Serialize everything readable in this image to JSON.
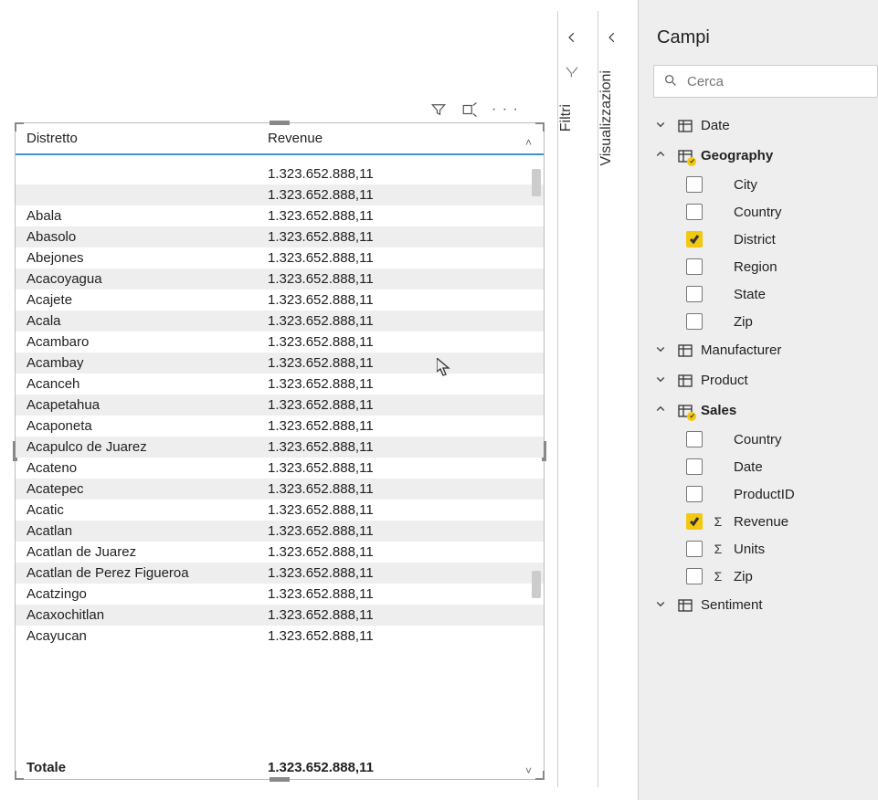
{
  "table": {
    "header": {
      "col_a": "Distretto",
      "col_b": "Revenue"
    },
    "rows": [
      {
        "a": " ",
        "b": "1.323.652.888,11"
      },
      {
        "a": " ",
        "b": "1.323.652.888,11"
      },
      {
        "a": "Abala",
        "b": "1.323.652.888,11"
      },
      {
        "a": "Abasolo",
        "b": "1.323.652.888,11"
      },
      {
        "a": "Abejones",
        "b": "1.323.652.888,11"
      },
      {
        "a": "Acacoyagua",
        "b": "1.323.652.888,11"
      },
      {
        "a": "Acajete",
        "b": "1.323.652.888,11"
      },
      {
        "a": "Acala",
        "b": "1.323.652.888,11"
      },
      {
        "a": "Acambaro",
        "b": "1.323.652.888,11"
      },
      {
        "a": "Acambay",
        "b": "1.323.652.888,11"
      },
      {
        "a": "Acanceh",
        "b": "1.323.652.888,11"
      },
      {
        "a": "Acapetahua",
        "b": "1.323.652.888,11"
      },
      {
        "a": "Acaponeta",
        "b": "1.323.652.888,11"
      },
      {
        "a": "Acapulco de Juarez",
        "b": "1.323.652.888,11"
      },
      {
        "a": "Acateno",
        "b": "1.323.652.888,11"
      },
      {
        "a": "Acatepec",
        "b": "1.323.652.888,11"
      },
      {
        "a": "Acatic",
        "b": "1.323.652.888,11"
      },
      {
        "a": "Acatlan",
        "b": "1.323.652.888,11"
      },
      {
        "a": "Acatlan de Juarez",
        "b": "1.323.652.888,11"
      },
      {
        "a": "Acatlan de Perez Figueroa",
        "b": "1.323.652.888,11"
      },
      {
        "a": "Acatzingo",
        "b": "1.323.652.888,11"
      },
      {
        "a": "Acaxochitlan",
        "b": "1.323.652.888,11"
      },
      {
        "a": "Acayucan",
        "b": "1.323.652.888,11"
      }
    ],
    "footer": {
      "label": "Totale",
      "value": "1.323.652.888,11"
    }
  },
  "rails": {
    "filtri": "Filtri",
    "visualizzazioni": "Visualizzazioni"
  },
  "fields": {
    "title": "Campi",
    "search_placeholder": "Cerca",
    "tables": {
      "date": {
        "label": "Date"
      },
      "geography": {
        "label": "Geography",
        "fields": {
          "city": "City",
          "country": "Country",
          "district": "District",
          "region": "Region",
          "state": "State",
          "zip": "Zip"
        }
      },
      "manufacturer": {
        "label": "Manufacturer"
      },
      "product": {
        "label": "Product"
      },
      "sales": {
        "label": "Sales",
        "fields": {
          "country": "Country",
          "date": "Date",
          "productid": "ProductID",
          "revenue": "Revenue",
          "units": "Units",
          "zip": "Zip"
        }
      },
      "sentiment": {
        "label": "Sentiment"
      }
    }
  }
}
